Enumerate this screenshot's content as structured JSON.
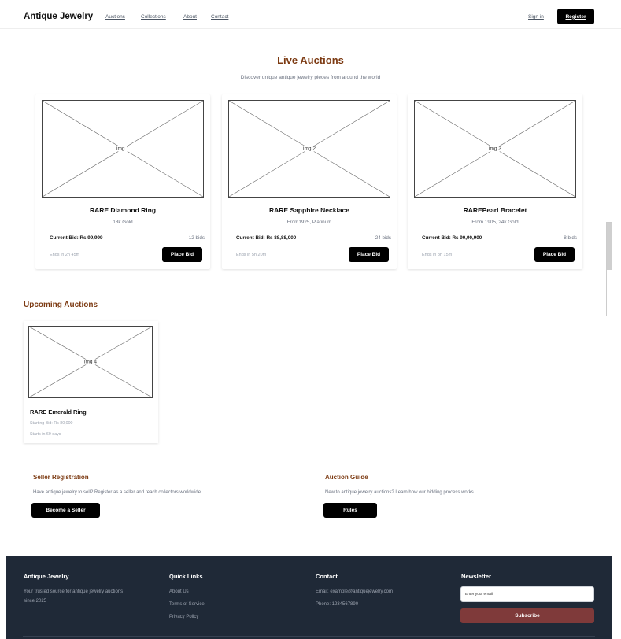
{
  "header": {
    "brand": "Antique Jewelry",
    "nav": [
      "Auctions",
      "Collections",
      "About",
      "Contact"
    ],
    "sign_in": "Sign in",
    "register": "Register"
  },
  "live": {
    "title": "Live Auctions",
    "subtitle": "Discover unique antique jewelry pieces from around the world",
    "items": [
      {
        "img": "img 1",
        "name": "RARE Diamond Ring",
        "detail": "18k Gold",
        "bid": "Current Bid: Rs 99,999",
        "bids": "12 bids",
        "ends": "Ends in 2h 45m",
        "button": "Place Bid"
      },
      {
        "img": "img 2",
        "name": "RARE Sapphire Necklace",
        "detail": "From1925, Platinum",
        "bid": "Current Bid: Rs 88,88,000",
        "bids": "24 bids",
        "ends": "Ends in 5h 20m",
        "button": "Place Bid"
      },
      {
        "img": "img 3",
        "name": "RAREPearl Bracelet",
        "detail": "From 1905, 24k Gold",
        "bid": "Current Bid: Rs 90,90,900",
        "bids": "8 bids",
        "ends": "Ends in 8h 15m",
        "button": "Place Bid"
      }
    ]
  },
  "upcoming": {
    "title": "Upcoming Auctions",
    "items": [
      {
        "img": "img 4",
        "name": "RARE Emerald Ring",
        "starting": "Starting Bid: Rs 80,000",
        "starts": "Starts in 69 days"
      }
    ]
  },
  "seller": {
    "title": "Seller Registration",
    "text": "Have antique jewelry to sell? Register as a seller and reach collectors worldwide.",
    "button": "Become a Seller"
  },
  "guide": {
    "title": "Auction Guide",
    "text": "New to antique jewelry auctions? Learn how our bidding process works.",
    "button": "Rules"
  },
  "footer": {
    "brand_title": "Antique Jewelry",
    "brand_text_1": "Your trusted source for antique jewelry auctions",
    "brand_text_2": "since 2025",
    "links_title": "Quick Links",
    "links": [
      "About Us",
      "Terms of Service",
      "Privacy Policy"
    ],
    "contact_title": "Contact",
    "email": "Email: example@antiquejewelry.com",
    "phone": "Phone: 1234567890",
    "news_title": "Newsletter",
    "email_placeholder": "Enter your email",
    "subscribe": "Subscribe"
  }
}
